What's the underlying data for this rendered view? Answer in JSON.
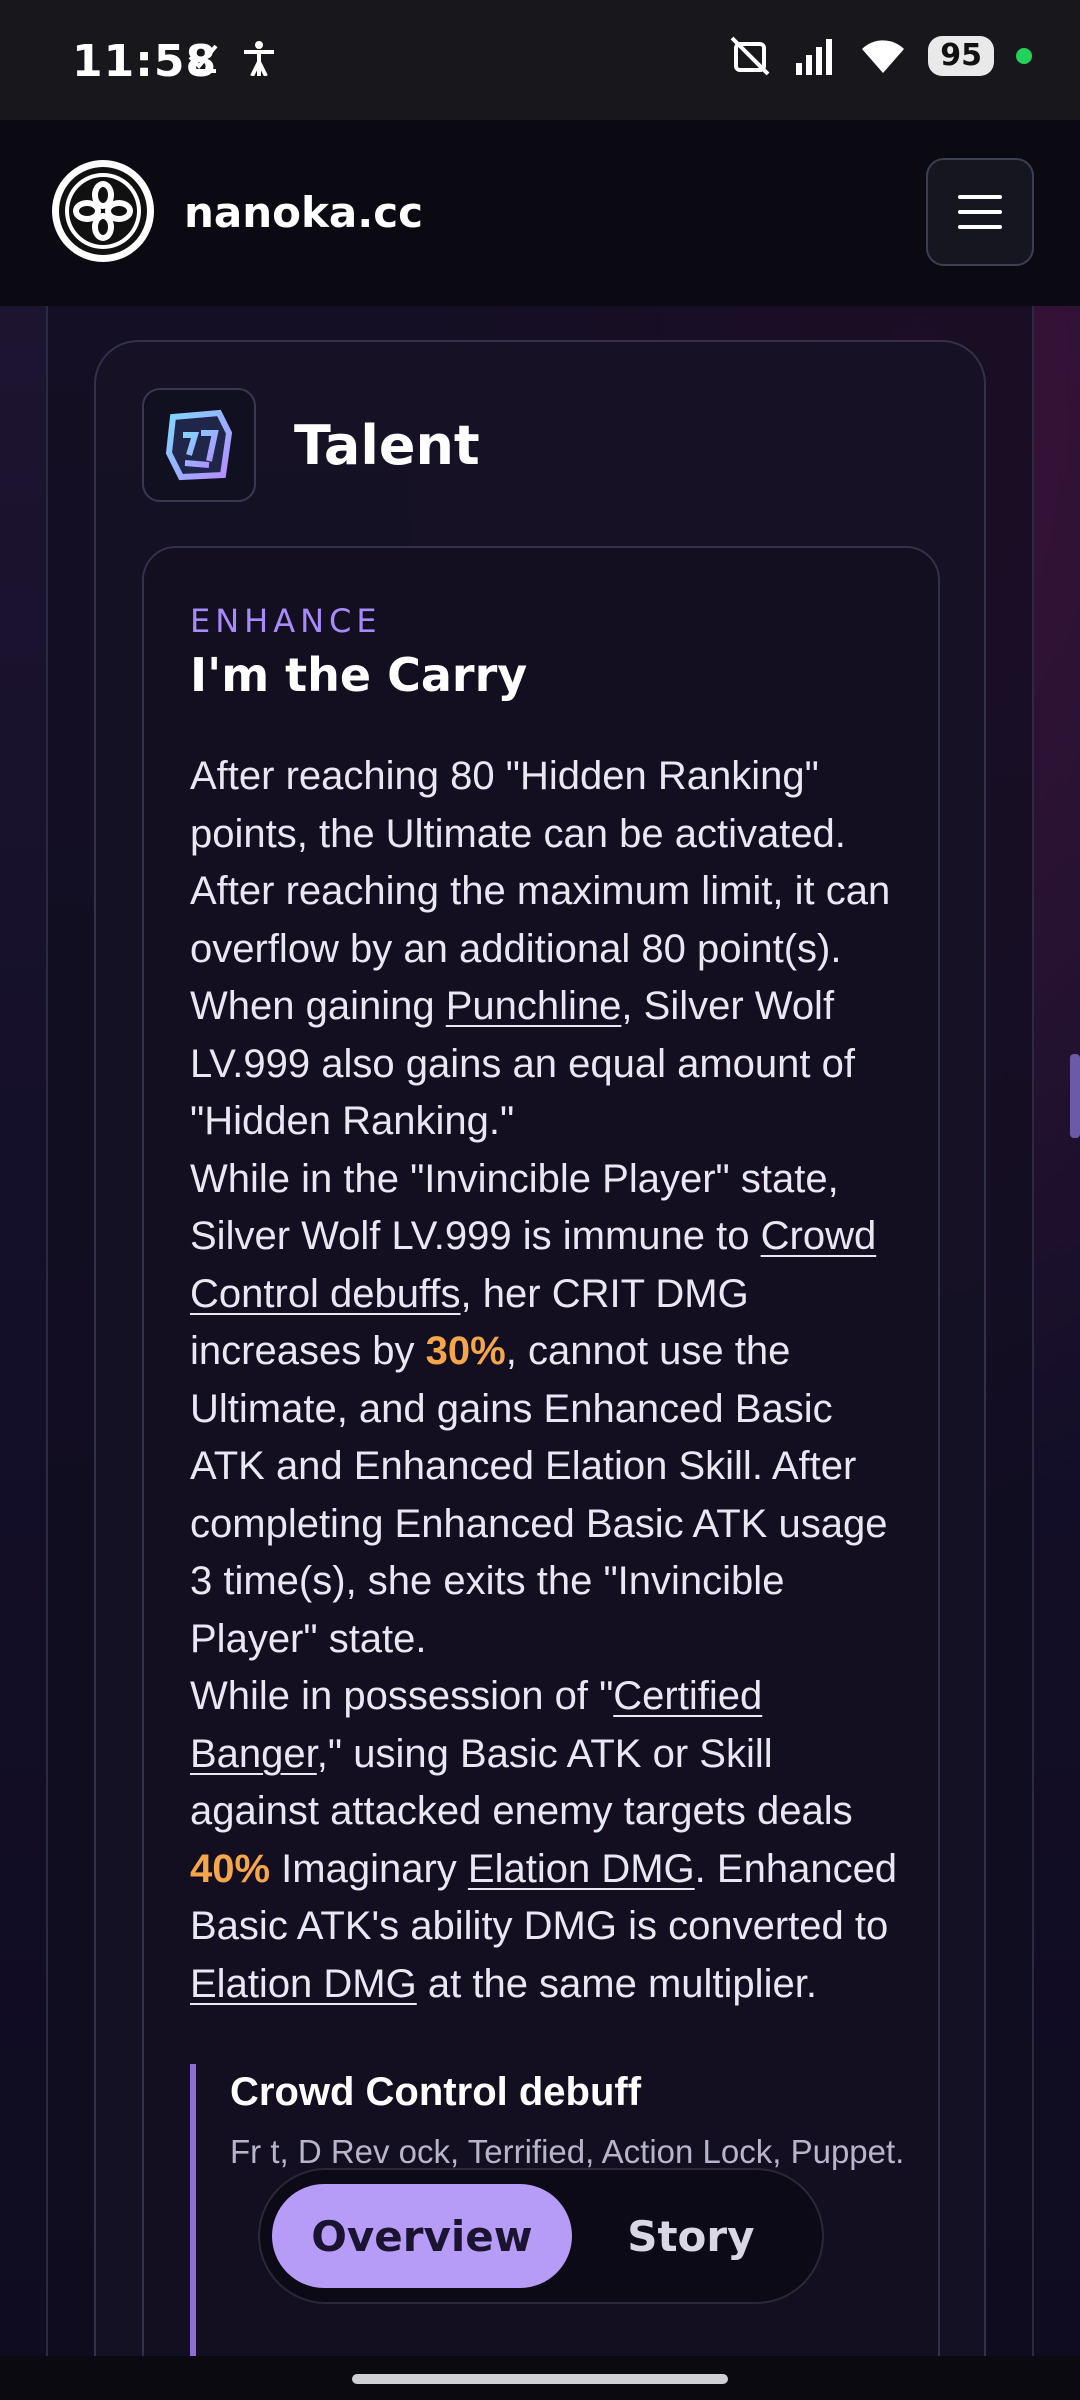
{
  "status_bar": {
    "time": "11:58",
    "battery": "95",
    "icons": [
      "check-icon",
      "accessibility-icon",
      "mute-icon",
      "signal-icon",
      "wifi-icon"
    ]
  },
  "header": {
    "site_name": "nanoka.cc"
  },
  "talent": {
    "section_title": "Talent",
    "tag": "ENHANCE",
    "name": "I'm the Carry",
    "desc": {
      "p1": "After reaching 80 \"Hidden Ranking\" points, the Ultimate can be activated. After reaching the maximum limit, it can overflow by an additional 80 point(s). When gaining ",
      "link_punchline": "Punchline",
      "p2": ", Silver Wolf LV.999 also gains an equal amount of \"Hidden Ranking.\"",
      "p3": "While in the \"Invincible Player\" state, Silver Wolf LV.999 is immune to ",
      "link_cc": "Crowd Control debuffs",
      "p4": ", her CRIT DMG increases by ",
      "hl_30": "30%",
      "p5": ", cannot use the Ultimate, and gains Enhanced Basic ATK and Enhanced Elation Skill. After completing Enhanced Basic ATK usage 3 time(s), she exits the \"Invincible Player\" state.",
      "p6": "While in possession of \"",
      "link_banger": "Certified Banger",
      "p7": ",\" using Basic ATK or Skill against attacked enemy targets deals ",
      "hl_40": "40%",
      "p8": " Imaginary ",
      "link_elation1": "Elation DMG",
      "p9": ". Enhanced Basic ATK's ability DMG is converted to ",
      "link_elation2": "Elation DMG",
      "p10": " at the same multiplier."
    },
    "note": {
      "title": "Crowd Control debuff",
      "text": "Fr                                                   t, D                                                 Rev                                            ock, Terrified, Action Lock, Puppet."
    }
  },
  "tabs": {
    "overview": "Overview",
    "story": "Story"
  },
  "colors": {
    "accent": "#b79cf7",
    "highlight": "#f5a54a",
    "tag": "#a78bfa"
  }
}
